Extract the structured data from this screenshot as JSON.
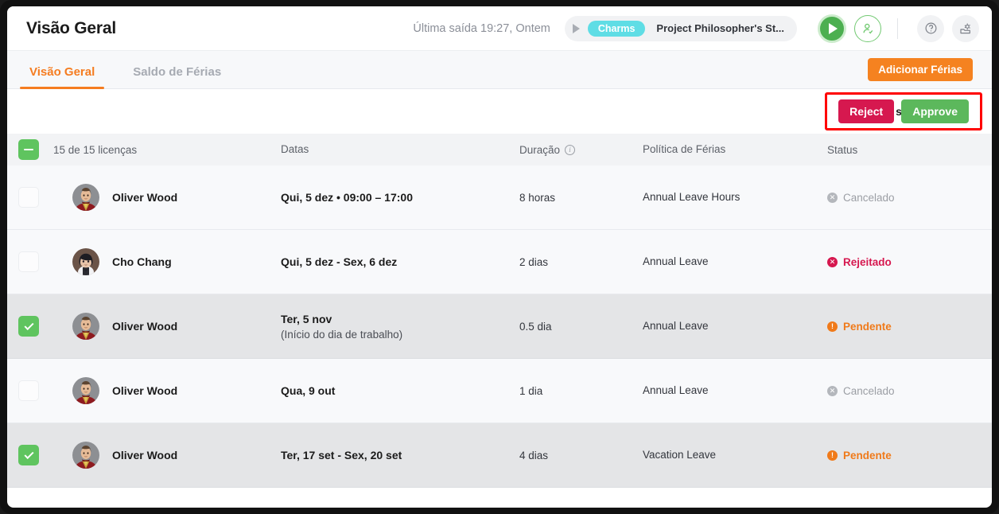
{
  "header": {
    "title": "Visão Geral",
    "last_exit": "Última saída 19:27, Ontem",
    "timer": {
      "play_icon": "play-icon",
      "project_tag": "Charms",
      "project_name": "Project Philosopher's St..."
    },
    "buttons": {
      "start_timer": "start-timer-icon",
      "attendance": "person-check-icon",
      "help": "question-mark-icon",
      "settings": "gear-settings-icon"
    }
  },
  "tabs": {
    "items": [
      {
        "label": "Visão Geral",
        "active": true
      },
      {
        "label": "Saldo de Férias",
        "active": false
      }
    ],
    "add_vacation_label": "Adicionar Férias"
  },
  "action_bar": {
    "selected_count_label": "2 selecionado",
    "reject_label": "Reject",
    "approve_label": "Approve",
    "highlight_color": "#ff0000"
  },
  "table": {
    "columns": {
      "licenses": "15 de 15 licenças",
      "dates": "Datas",
      "duration": "Duração",
      "duration_info_icon": "info-icon",
      "policy": "Política de Férias",
      "status": "Status"
    },
    "header_checkbox_state": "indeterminate",
    "rows": [
      {
        "checked": false,
        "avatar": "avatar-oliver-wood",
        "name": "Oliver Wood",
        "date_main": "Qui, 5 dez • 09:00 – 17:00",
        "date_sub": "",
        "duration": "8 horas",
        "policy": "Annual Leave Hours",
        "status": "Cancelado",
        "status_kind": "cancelado"
      },
      {
        "checked": false,
        "avatar": "avatar-cho-chang",
        "name": "Cho Chang",
        "date_main": "Qui, 5 dez - Sex, 6 dez",
        "date_sub": "",
        "duration": "2 dias",
        "policy": "Annual Leave",
        "status": "Rejeitado",
        "status_kind": "rejeitado"
      },
      {
        "checked": true,
        "avatar": "avatar-oliver-wood",
        "name": "Oliver Wood",
        "date_main": "Ter, 5 nov",
        "date_sub": "(Início do dia de trabalho)",
        "duration": "0.5 dia",
        "policy": "Annual Leave",
        "status": "Pendente",
        "status_kind": "pendente"
      },
      {
        "checked": false,
        "avatar": "avatar-oliver-wood",
        "name": "Oliver Wood",
        "date_main": "Qua, 9 out",
        "date_sub": "",
        "duration": "1 dia",
        "policy": "Annual Leave",
        "status": "Cancelado",
        "status_kind": "cancelado"
      },
      {
        "checked": true,
        "avatar": "avatar-oliver-wood",
        "name": "Oliver Wood",
        "date_main": "Ter, 17 set - Sex, 20 set",
        "date_sub": "",
        "duration": "4 dias",
        "policy": "Vacation Leave",
        "status": "Pendente",
        "status_kind": "pendente"
      }
    ]
  },
  "colors": {
    "accent_orange": "#f57c20",
    "approve_green": "#5cb85c",
    "reject_crimson": "#d6184f",
    "tag_cyan": "#5fdde5",
    "pending_orange": "#f07a1a",
    "cancelled_grey": "#b4b7bc"
  }
}
